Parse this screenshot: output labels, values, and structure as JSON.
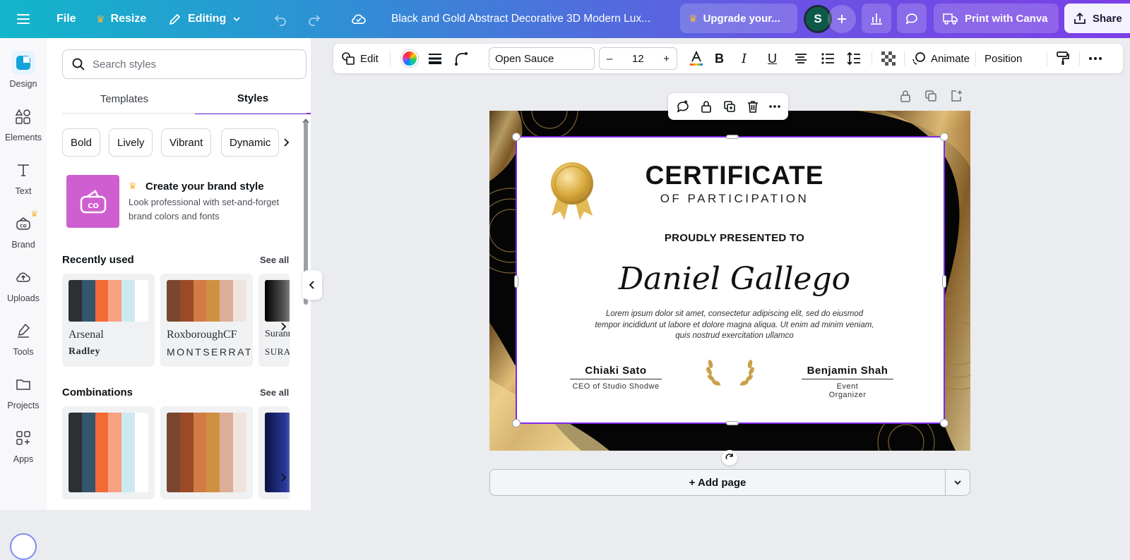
{
  "topbar": {
    "file_label": "File",
    "resize_label": "Resize",
    "editing_label": "Editing",
    "doc_title": "Black and Gold Abstract Decorative 3D Modern Lux...",
    "upgrade_label": "Upgrade your...",
    "avatar_initial": "S",
    "print_label": "Print with Canva",
    "share_label": "Share"
  },
  "rail": {
    "items": [
      {
        "label": "Design"
      },
      {
        "label": "Elements"
      },
      {
        "label": "Text"
      },
      {
        "label": "Brand"
      },
      {
        "label": "Uploads"
      },
      {
        "label": "Tools"
      },
      {
        "label": "Projects"
      },
      {
        "label": "Apps"
      }
    ]
  },
  "panel": {
    "search_placeholder": "Search styles",
    "tabs": [
      "Templates",
      "Styles"
    ],
    "chips": [
      "Bold",
      "Lively",
      "Vibrant",
      "Dynamic"
    ],
    "promo": {
      "title": "Create your brand style",
      "desc": "Look professional with set-and-forget brand colors and fonts"
    },
    "recently_used": {
      "title": "Recently used",
      "see_all": "See all",
      "cards": [
        {
          "font1": "Arsenal",
          "font2": "Radley",
          "colors": [
            "#2b3034",
            "#34566c",
            "#f26a35",
            "#f9a183",
            "#cde9f0",
            "#ffffff"
          ]
        },
        {
          "font1": "RoxboroughCF",
          "font2": "MONTSERRAT",
          "colors": [
            "#7a4632",
            "#9b4a26",
            "#d37b46",
            "#cf9141",
            "#dcad97",
            "#efe4dc"
          ]
        },
        {
          "font1": "Suranna",
          "font2": "SURANNA",
          "colors": [
            "#000000",
            "#6b6b6b",
            "#ffffff"
          ]
        }
      ]
    },
    "combinations": {
      "title": "Combinations",
      "see_all": "See all",
      "cards": [
        {
          "colors": [
            "#2b3034",
            "#34566c",
            "#f26a35",
            "#f9a183",
            "#cde9f0",
            "#ffffff"
          ]
        },
        {
          "colors": [
            "#7a4632",
            "#9b4a26",
            "#d37b46",
            "#cf9141",
            "#dcad97",
            "#efe4dc"
          ]
        },
        {
          "colors": [
            "#0a1240",
            "#2a3a9c",
            "#ffffff"
          ]
        }
      ]
    }
  },
  "toolbar": {
    "edit_label": "Edit",
    "font_name": "Open Sauce",
    "font_size": "12",
    "minus": "–",
    "plus": "+",
    "animate_label": "Animate",
    "position_label": "Position"
  },
  "certificate": {
    "title": "CERTIFICATE",
    "subtitle": "OF PARTICIPATION",
    "presented": "PROUDLY PRESENTED TO",
    "recipient": "Daniel Gallego",
    "body": "Lorem ipsum dolor sit amet, consectetur adipiscing elit, sed do eiusmod tempor incididunt ut labore et dolore magna aliqua. Ut enim ad minim veniam, quis nostrud exercitation ullamco",
    "signer1_name": "Chiaki Sato",
    "signer1_role": "CEO of Studio Shodwe",
    "signer2_name": "Benjamin Shah",
    "signer2_role": "Event Organizer"
  },
  "canvas": {
    "add_page_label": "+ Add page"
  },
  "colors": {
    "accent": "#7d2ae8",
    "gold": "#c9a04a",
    "promo_pink": "#cf5fd0"
  }
}
